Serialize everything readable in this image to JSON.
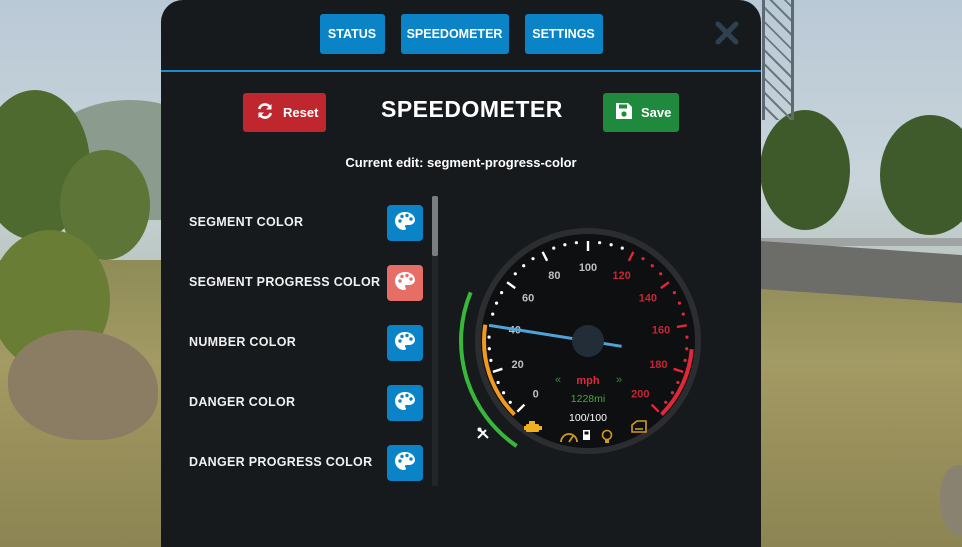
{
  "tabs": [
    {
      "label": "STATUS"
    },
    {
      "label": "SPEEDOMETER"
    },
    {
      "label": "SETTINGS"
    }
  ],
  "header": {
    "reset_label": "Reset",
    "title": "SPEEDOMETER",
    "save_label": "Save",
    "current_edit": "Current edit: segment-progress-color"
  },
  "settings": [
    {
      "label": "SEGMENT COLOR",
      "active": false
    },
    {
      "label": "SEGMENT PROGRESS COLOR",
      "active": true
    },
    {
      "label": "NUMBER COLOR",
      "active": false
    },
    {
      "label": "DANGER COLOR",
      "active": false
    },
    {
      "label": "DANGER PROGRESS COLOR",
      "active": false
    }
  ],
  "speedometer": {
    "scale": [
      "0",
      "20",
      "40",
      "60",
      "80",
      "100",
      "120",
      "140",
      "160",
      "180",
      "200"
    ],
    "speed_value": 40,
    "unit": "mph",
    "odometer": "1228mi",
    "fuel": "100/100",
    "left_arrows": "«",
    "right_arrows": "»"
  },
  "colors": {
    "accent": "#0a84c6",
    "active_swatch": "#e66e66",
    "reset": "#c0262e",
    "save": "#1f8a3e",
    "danger": "#e0283a",
    "needle": "#4fa3d6",
    "progress_green": "#39b73a",
    "progress_orange": "#f09a1e"
  },
  "icons": {
    "reset": "refresh-icon",
    "save": "floppy-disk-icon",
    "palette": "palette-icon",
    "close": "close-icon",
    "tools": "tools-icon",
    "engine": "engine-icon",
    "gauge": "gauge-icon",
    "fuel": "fuel-pump-icon",
    "light": "light-bulb-icon",
    "door": "door-icon"
  }
}
